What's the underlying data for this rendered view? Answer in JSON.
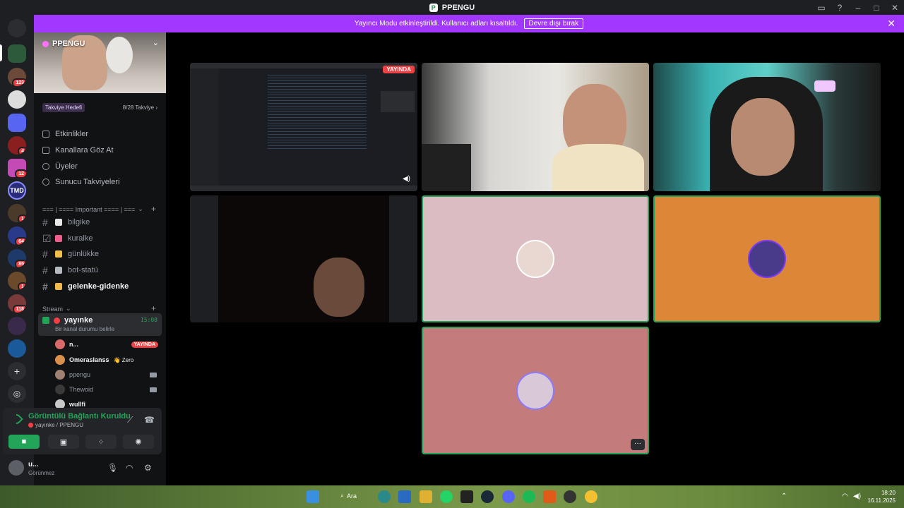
{
  "window": {
    "title": "PPENGU"
  },
  "banner": {
    "text": "Yayıncı Modu etkinleştirildi. Kullanıcı adları kısaltıldı.",
    "button": "Devre dışı bırak"
  },
  "rail": {
    "badges": [
      "123",
      "4",
      "12",
      "1",
      "64",
      "85",
      "1",
      "118"
    ],
    "tmd_label": "TMD"
  },
  "server": {
    "name": "PPENGU",
    "boost_goal": "Takviye Hedefi",
    "boost_count": "8/28 Takviye",
    "menu": [
      "Etkinlikler",
      "Kanallara Göz At",
      "Üyeler",
      "Sunucu Takviyeleri"
    ]
  },
  "categories": {
    "important": "=== | ==== Important ==== | ===",
    "stream": "Stream"
  },
  "channels": [
    "bilgike",
    "kuralke",
    "günlükke",
    "bot-statü",
    "gelenke-gidenke"
  ],
  "voice": {
    "channel": "yayınke",
    "time": "15:08",
    "status": "Bir kanal durumu belirle",
    "users": [
      {
        "name": "n...",
        "badge": "YAYINDA"
      },
      {
        "name": "Omeraslanss",
        "tag": "Zero"
      },
      {
        "name": "ppengu"
      },
      {
        "name": "Thewoid"
      },
      {
        "name": "wullfi"
      }
    ]
  },
  "connection": {
    "title": "Görüntülü Bağlantı Kuruldu",
    "sub": "yayınke / PPENGU"
  },
  "user": {
    "name": "u...",
    "status": "Görünmez"
  },
  "stage": {
    "live_badge": "YAYINDA"
  },
  "taskbar": {
    "search": "Ara",
    "time": "18:20",
    "date": "16.11.2025"
  },
  "colors": {
    "accent_purple": "#a238ff",
    "speaking_green": "#23a559",
    "live_red": "#ed4245"
  }
}
